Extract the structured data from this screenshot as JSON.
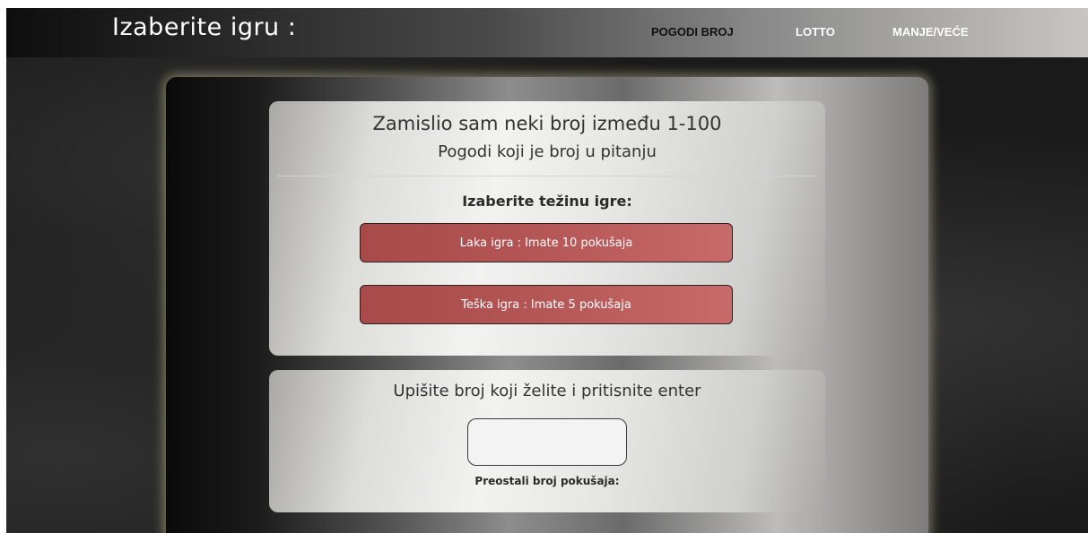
{
  "header": {
    "brand": "Izaberite igru :",
    "nav": [
      {
        "label": "POGODI BROJ",
        "active": true
      },
      {
        "label": "LOTTO",
        "active": false
      },
      {
        "label": "MANJE/VEĆE",
        "active": false
      }
    ]
  },
  "game": {
    "title": "Zamislio sam neki broj između 1-100",
    "subtitle": "Pogodi koji je broj u pitanju",
    "difficulty_label": "Izaberite težinu igre:",
    "buttons": {
      "easy": "Laka igra : Imate 10 pokušaja",
      "hard": "Teška igra : Imate 5 pokušaja"
    }
  },
  "guess": {
    "prompt": "Upišite broj koji želite i pritisnite enter",
    "input_value": "",
    "remaining_label": "Preostali broj pokušaja:"
  },
  "colors": {
    "button_red": "#b45555",
    "glow": "#e6e1aa"
  }
}
